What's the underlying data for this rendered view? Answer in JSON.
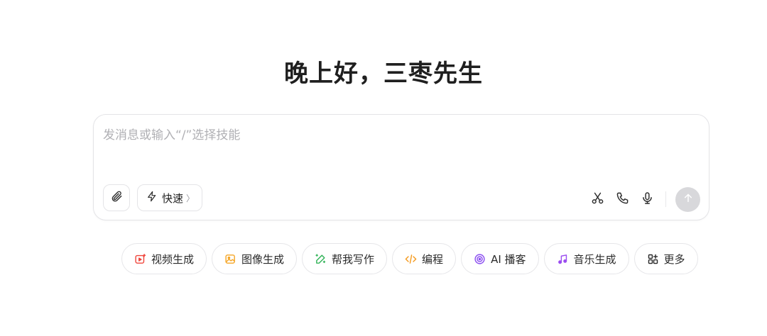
{
  "greeting": "晚上好，三枣先生",
  "composer": {
    "placeholder": "发消息或输入“/”选择技能",
    "mode_label": "快速",
    "mode_chevron": "〉"
  },
  "icons": {
    "attach": "paperclip-icon",
    "mode": "lightning-icon",
    "scissors": "scissors-icon",
    "phone": "phone-icon",
    "mic": "microphone-icon",
    "send": "arrow-up-icon"
  },
  "chips": [
    {
      "label": "视频生成",
      "icon": "video-generate-icon",
      "color": "#f0463c"
    },
    {
      "label": "图像生成",
      "icon": "image-generate-icon",
      "color": "#f5a524"
    },
    {
      "label": "帮我写作",
      "icon": "pen-write-icon",
      "color": "#34b45a"
    },
    {
      "label": "编程",
      "icon": "code-icon",
      "color": "#f59a1e"
    },
    {
      "label": "AI 播客",
      "icon": "podcast-icon",
      "color": "#8a4df0"
    },
    {
      "label": "音乐生成",
      "icon": "music-icon",
      "color": "#9b4df0"
    },
    {
      "label": "更多",
      "icon": "more-apps-icon",
      "color": "#2a2a2a"
    }
  ],
  "colors": {
    "send_disabled": "#d8d8db",
    "border": "#e4e4e7"
  }
}
